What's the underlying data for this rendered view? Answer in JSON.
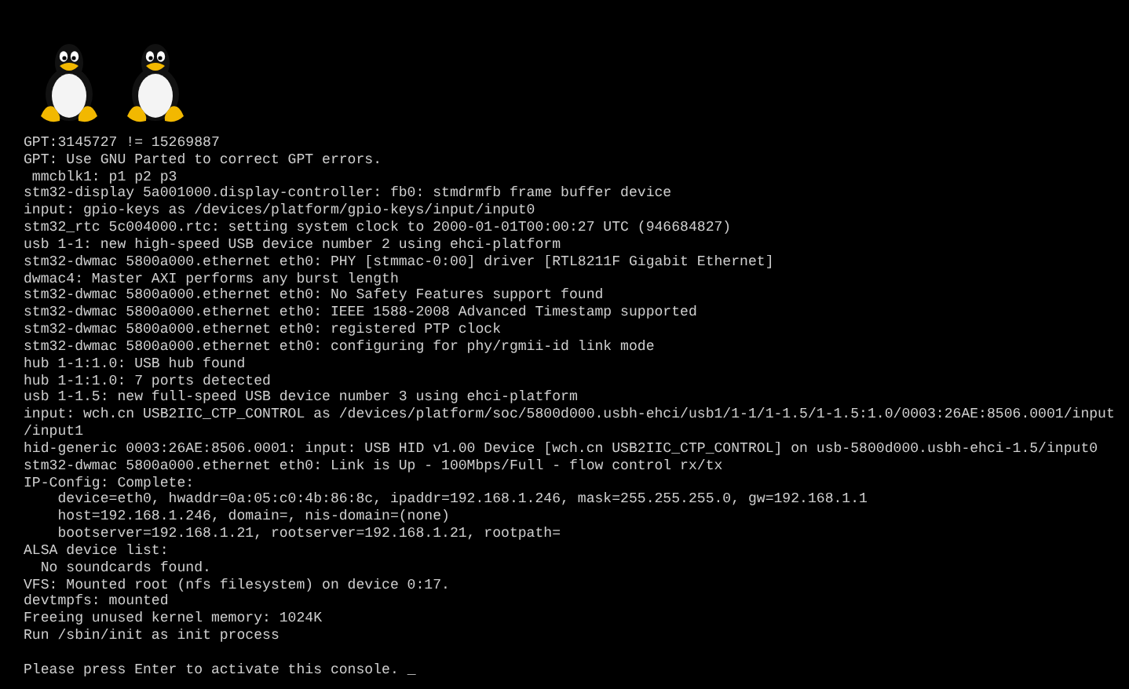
{
  "boot_logos": [
    {
      "kind": "tux"
    },
    {
      "kind": "tux"
    }
  ],
  "console_lines": [
    "GPT:3145727 != 15269887",
    "GPT: Use GNU Parted to correct GPT errors.",
    " mmcblk1: p1 p2 p3",
    "stm32-display 5a001000.display-controller: fb0: stmdrmfb frame buffer device",
    "input: gpio-keys as /devices/platform/gpio-keys/input/input0",
    "stm32_rtc 5c004000.rtc: setting system clock to 2000-01-01T00:00:27 UTC (946684827)",
    "usb 1-1: new high-speed USB device number 2 using ehci-platform",
    "stm32-dwmac 5800a000.ethernet eth0: PHY [stmmac-0:00] driver [RTL8211F Gigabit Ethernet]",
    "dwmac4: Master AXI performs any burst length",
    "stm32-dwmac 5800a000.ethernet eth0: No Safety Features support found",
    "stm32-dwmac 5800a000.ethernet eth0: IEEE 1588-2008 Advanced Timestamp supported",
    "stm32-dwmac 5800a000.ethernet eth0: registered PTP clock",
    "stm32-dwmac 5800a000.ethernet eth0: configuring for phy/rgmii-id link mode",
    "hub 1-1:1.0: USB hub found",
    "hub 1-1:1.0: 7 ports detected",
    "usb 1-1.5: new full-speed USB device number 3 using ehci-platform",
    "input: wch.cn USB2IIC_CTP_CONTROL as /devices/platform/soc/5800d000.usbh-ehci/usb1/1-1/1-1.5/1-1.5:1.0/0003:26AE:8506.0001/input",
    "/input1",
    "hid-generic 0003:26AE:8506.0001: input: USB HID v1.00 Device [wch.cn USB2IIC_CTP_CONTROL] on usb-5800d000.usbh-ehci-1.5/input0",
    "stm32-dwmac 5800a000.ethernet eth0: Link is Up - 100Mbps/Full - flow control rx/tx",
    "IP-Config: Complete:",
    "    device=eth0, hwaddr=0a:05:c0:4b:86:8c, ipaddr=192.168.1.246, mask=255.255.255.0, gw=192.168.1.1",
    "    host=192.168.1.246, domain=, nis-domain=(none)",
    "    bootserver=192.168.1.21, rootserver=192.168.1.21, rootpath=",
    "ALSA device list:",
    "  No soundcards found.",
    "VFS: Mounted root (nfs filesystem) on device 0:17.",
    "devtmpfs: mounted",
    "Freeing unused kernel memory: 1024K",
    "Run /sbin/init as init process"
  ],
  "prompt": "Please press Enter to activate this console.",
  "cursor": "_"
}
